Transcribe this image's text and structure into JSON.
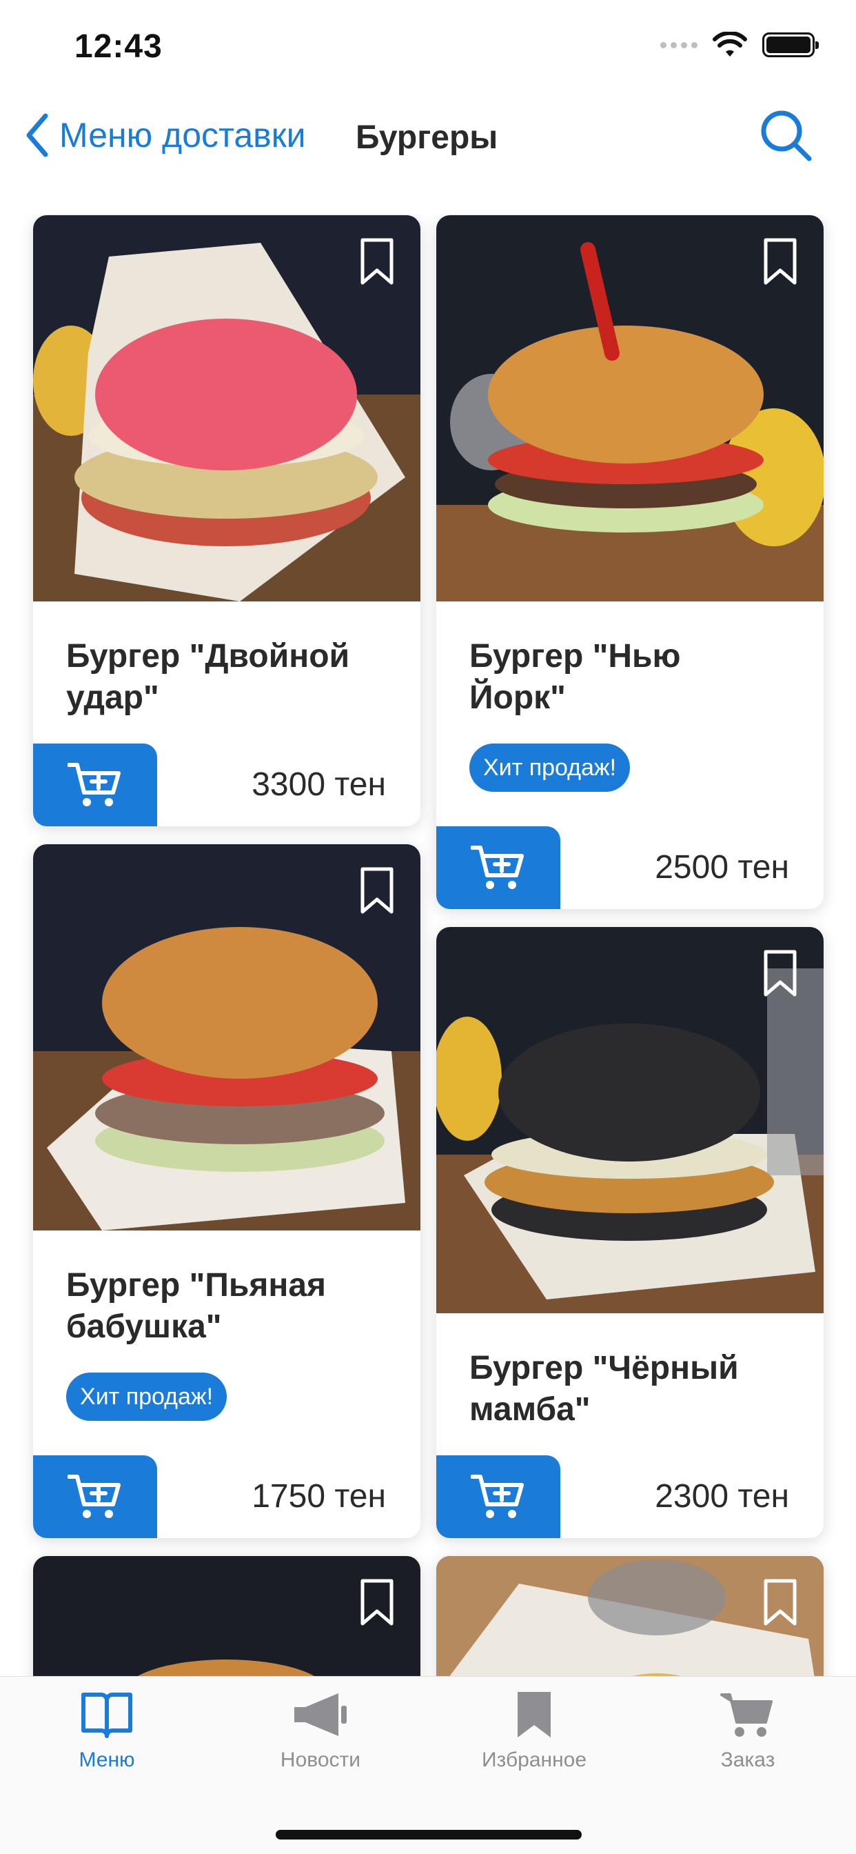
{
  "status_bar": {
    "time": "12:43"
  },
  "nav": {
    "back_label": "Меню доставки",
    "title": "Бургеры"
  },
  "products": [
    {
      "title": "Бургер \"Двойной удар\"",
      "badge": "",
      "price": "3300 тен",
      "bun_color": "#ec5a6f"
    },
    {
      "title": "Бургер \"Нью Йорк\"",
      "badge": "Хит продаж!",
      "price": "2500 тен",
      "bun_color": "#d6923f"
    },
    {
      "title": "Бургер \"Пьяная бабушка\"",
      "badge": "Хит продаж!",
      "price": "1750 тен",
      "bun_color": "#cf8a3e"
    },
    {
      "title": "Бургер \"Чёрный мамба\"",
      "badge": "",
      "price": "2300 тен",
      "bun_color": "#2b2b2e"
    }
  ],
  "tabs": [
    {
      "label": "Меню",
      "icon": "book-icon",
      "active": true
    },
    {
      "label": "Новости",
      "icon": "megaphone-icon",
      "active": false
    },
    {
      "label": "Избранное",
      "icon": "bookmark-icon",
      "active": false
    },
    {
      "label": "Заказ",
      "icon": "cart-icon",
      "active": false
    }
  ],
  "colors": {
    "accent": "#1b7bd9",
    "inactive": "#8e8e93",
    "title": "#2a2a2c"
  }
}
